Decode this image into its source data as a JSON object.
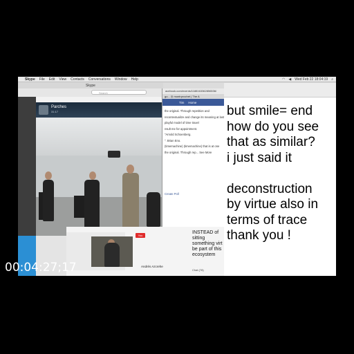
{
  "menubar": {
    "app": "Skype",
    "items": [
      "File",
      "Edit",
      "View",
      "Contacts",
      "Conversations",
      "Window",
      "Help"
    ],
    "clock": "Wed Feb 22 18:04:19"
  },
  "skype": {
    "window_title": "Skype",
    "search_placeholder": "Search",
    "caller_name": "Parches",
    "call_time": "31:17"
  },
  "browser": {
    "url": "acebook.com/events/1188163362856536/",
    "tabs": "go... ◎ montrprochet | The A",
    "nav": [
      "Tim",
      "Home"
    ],
    "text": [
      "the original. Through repetition and",
      "recontextualize and change its meaning at last",
      "playful model of time travel",
      "nsult me for appointment.",
      "\"Arnold Schoenberg.",
      "\". Brian Eno.",
      "(timemachine) (timemachine) that is at one",
      "the original. Through rep... See More"
    ],
    "action": "Create Poll"
  },
  "stream": {
    "yt_label": "You",
    "person_label": "Andrés Azcrehe",
    "chat_lines": [
      "INSTEAD of",
      "sitting",
      "something virt",
      "be part of this",
      "ecosystem"
    ],
    "chat_count": "Chat (78)"
  },
  "notes": {
    "lines": [
      "but smile= end",
      "how do you see",
      "that as similar?",
      "i just said it",
      "",
      "deconstruction",
      "by virtue also in",
      "terms of trace",
      "thank you !"
    ]
  },
  "timecode": "00:04:27;17"
}
